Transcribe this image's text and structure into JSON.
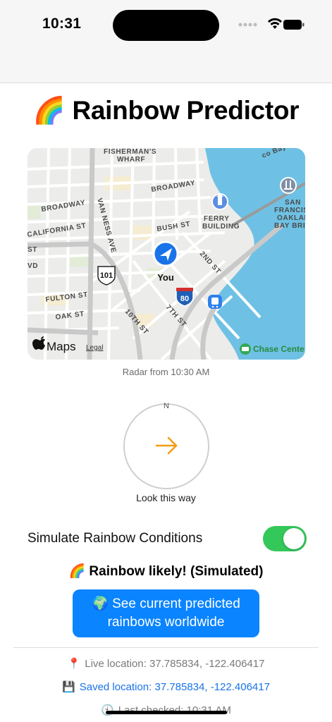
{
  "status_bar": {
    "time": "10:31"
  },
  "header": {
    "title": "🌈 Rainbow Predictor"
  },
  "map": {
    "labels": {
      "fishermans_wharf": "FISHERMAN'S",
      "wharf": "WHARF",
      "broadway_1": "BROADWAY",
      "broadway_2": "BROADWAY",
      "california": "CALIFORNIA ST",
      "bush": "BUSH ST",
      "van_ness": "VAN NESS AVE",
      "ferry_1": "FERRY",
      "ferry_2": "BUILDING",
      "sf_bay_1": "SAN",
      "sf_bay_2": "FRANCISCO",
      "sf_bay_3": "OAKLAND",
      "sf_bay_4": "BAY BRIDG",
      "bay": "co Bay Fer",
      "second_st": "2ND ST",
      "fulton": "FULTON ST",
      "oak": "OAK ST",
      "tenth": "10TH ST",
      "seventh": "7TH ST",
      "st_left": "ST",
      "vd": "VD",
      "you": "You",
      "hwy101": "101",
      "hwy80": "80",
      "chase": "Chase Cente",
      "maps_brand": "Maps",
      "legal": "Legal"
    }
  },
  "radar": {
    "caption": "Radar from 10:30 AM"
  },
  "compass": {
    "north": "N",
    "caption": "Look this way"
  },
  "simulate": {
    "label": "Simulate Rainbow Conditions",
    "enabled": true
  },
  "prediction": {
    "status": "🌈 Rainbow likely! (Simulated)"
  },
  "cta": {
    "line1": "🌍 See current predicted",
    "line2": "rainbows worldwide"
  },
  "info": {
    "live_icon": "📍",
    "live": "Live location: 37.785834, -122.406417",
    "saved_icon": "💾",
    "saved": "Saved location: 37.785834, -122.406417",
    "last_icon": "🕙",
    "last": "Last checked: 10:31 AM"
  },
  "colors": {
    "accent": "#0a84ff",
    "toggle_on": "#34c759",
    "water": "#6ec1e4"
  }
}
